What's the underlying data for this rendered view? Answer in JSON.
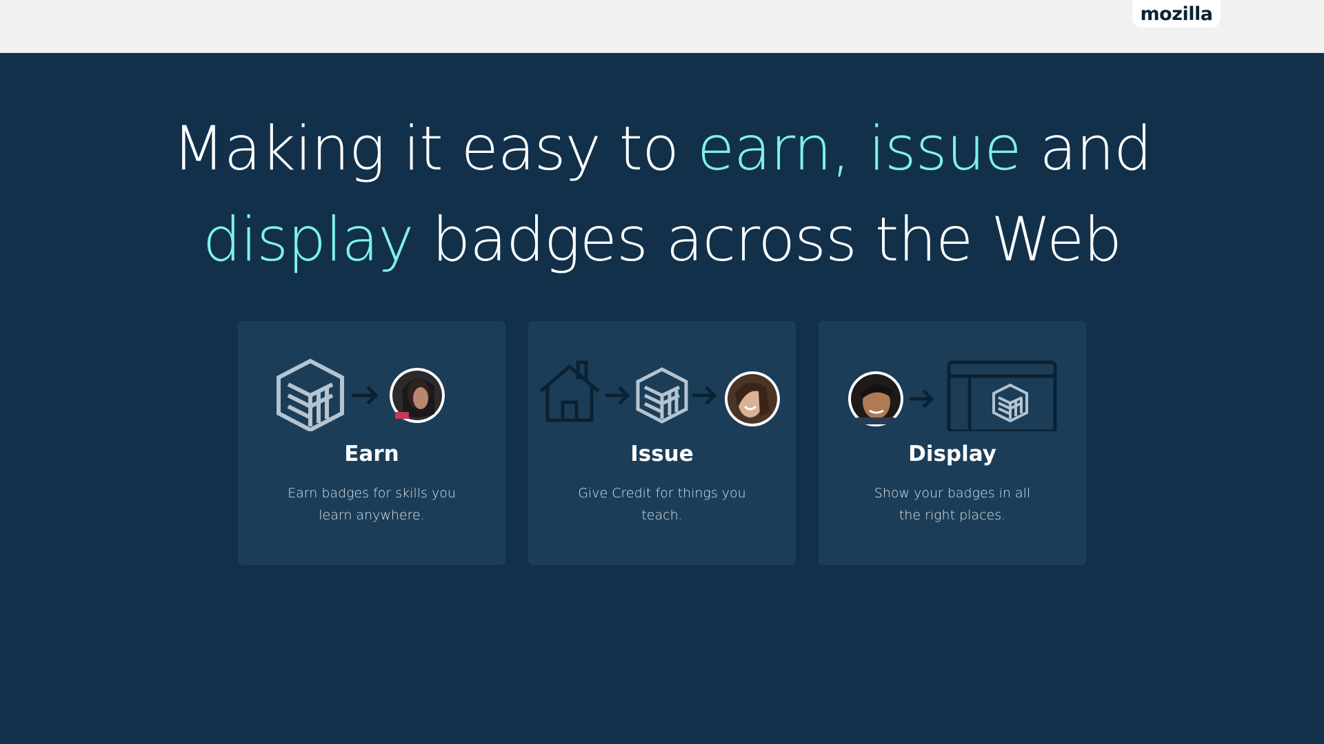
{
  "header": {
    "brand": "mozilla"
  },
  "hero": {
    "part1": "Making it easy to ",
    "highlight1": "earn, issue",
    "part2": " and",
    "highlight2": "display",
    "part3": " badges across the Web"
  },
  "cards": [
    {
      "title": "Earn",
      "desc_line1": "Earn badges for skills you",
      "desc_line2": "learn anywhere.",
      "icons": [
        "badge-icon",
        "arrow-right-icon",
        "earner-avatar"
      ]
    },
    {
      "title": "Issue",
      "desc_line1": "Give Credit for things you",
      "desc_line2": "teach.",
      "icons": [
        "school-house-icon",
        "arrow-right-icon",
        "badge-icon",
        "arrow-right-icon",
        "learner-avatar"
      ]
    },
    {
      "title": "Display",
      "desc_line1": "Show your badges in all",
      "desc_line2": "the right places.",
      "icons": [
        "user-avatar",
        "arrow-right-icon",
        "browser-window-icon",
        "badge-icon"
      ]
    }
  ],
  "colors": {
    "background": "#12304a",
    "card": "#1c3d57",
    "highlight": "#7ff2e6",
    "topbar": "#f0f2f2"
  }
}
